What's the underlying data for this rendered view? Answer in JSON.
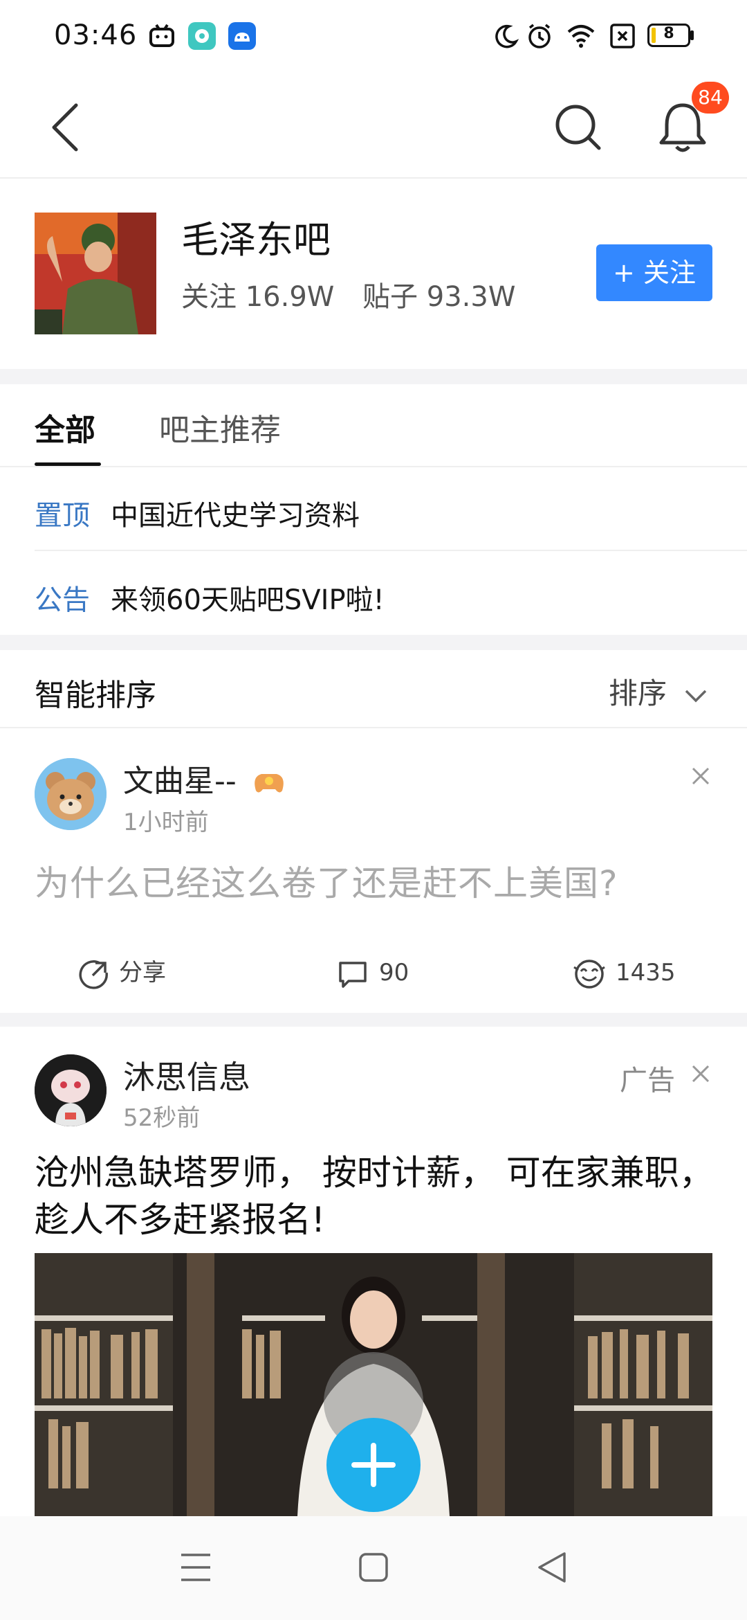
{
  "status_bar": {
    "time": "03:46",
    "battery": "8",
    "icons": [
      "bilibili-icon",
      "chat-app-icon",
      "android-app-icon",
      "moon-icon",
      "alarm-icon",
      "wifi-icon",
      "sim-icon",
      "battery-icon"
    ]
  },
  "top_nav": {
    "back_icon": "back-arrow-icon",
    "search_icon": "search-icon",
    "bell_icon": "bell-icon",
    "notification_count": "84"
  },
  "forum": {
    "name": "毛泽东吧",
    "followers_label": "关注 16.9W",
    "posts_label": "贴子 93.3W",
    "follow_button": "+ 关注"
  },
  "tabs": [
    {
      "label": "全部",
      "active": true
    },
    {
      "label": "吧主推荐",
      "active": false
    }
  ],
  "pinned": [
    {
      "tag": "置顶",
      "text": "中国近代史学习资料"
    },
    {
      "tag": "公告",
      "text": "来领60天贴吧SVIP啦!"
    }
  ],
  "sort": {
    "title": "智能排序",
    "button": "排序"
  },
  "post": {
    "username": "文曲星--",
    "time": "1小时前",
    "title": "为什么已经这么卷了还是赶不上美国?",
    "share_label": "分享",
    "comments": "90",
    "likes": "1435"
  },
  "ad": {
    "username": "沐思信息",
    "time": "52秒前",
    "label": "广告",
    "title": "沧州急缺塔罗师， 按时计薪， 可在家兼职， 趁人不多赶紧报名!"
  },
  "colors": {
    "accent": "#3388ff",
    "badge": "#ff4b1f",
    "fab": "#1fb0ec",
    "tag": "#3a78c4"
  }
}
